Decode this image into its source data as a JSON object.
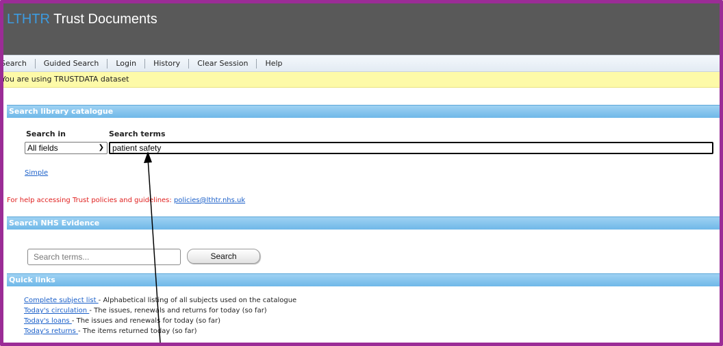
{
  "app": {
    "brand": "LTHTR",
    "title": "Trust Documents"
  },
  "nav": [
    "Search",
    "Guided Search",
    "Login",
    "History",
    "Clear Session",
    "Help"
  ],
  "notice": "You are using TRUSTDATA dataset",
  "catalogue": {
    "heading": "Search library catalogue",
    "search_in_label": "Search in",
    "search_terms_label": "Search terms",
    "search_in_value": "All fields",
    "search_terms_value": "patient safety",
    "simple_link": "Simple",
    "help_text": "For help accessing Trust policies and guidelines:",
    "help_email": "policies@lthtr.nhs.uk"
  },
  "nhs": {
    "heading": "Search NHS Evidence",
    "placeholder": "Search terms...",
    "button": "Search"
  },
  "quick_links": {
    "heading": "Quick links",
    "items": [
      {
        "link": "Complete subject list ",
        "desc": "- Alphabetical listing of all subjects used on the catalogue"
      },
      {
        "link": "Today's circulation ",
        "desc": "- The issues, renewals and returns for today (so far)"
      },
      {
        "link": "Today's loans ",
        "desc": "- The issues and renewals for today (so far)"
      },
      {
        "link": "Today's returns ",
        "desc": "- The items returned today (so far)"
      }
    ]
  },
  "colors": {
    "frame": "#9b2c96",
    "header": "#595959",
    "section": "#6fb8e8",
    "notice": "#fdfaa8",
    "help": "#e0201f"
  }
}
